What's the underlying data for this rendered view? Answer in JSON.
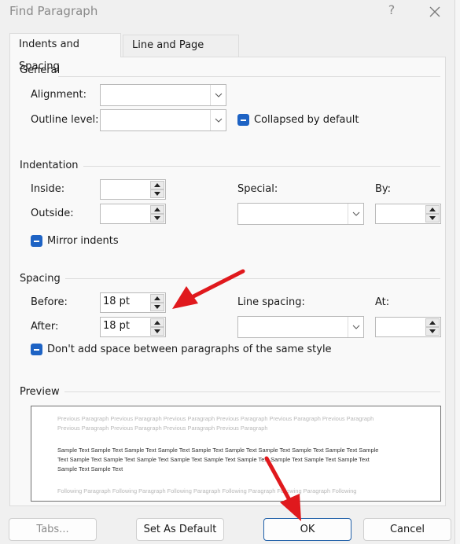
{
  "window": {
    "title": "Find Paragraph",
    "help_label": "?",
    "close_icon": "close-icon"
  },
  "tabs": [
    {
      "label": "Indents and Spacing",
      "mnemonic": "I",
      "active": true
    },
    {
      "label": "Line and Page Breaks",
      "mnemonic": "P",
      "active": false
    }
  ],
  "general": {
    "title": "General",
    "alignment_label": "Alignment:",
    "alignment_value": "",
    "outline_label": "Outline level:",
    "outline_value": "",
    "collapsed_label": "Collapsed by default",
    "collapsed_state": "indeterminate"
  },
  "indentation": {
    "title": "Indentation",
    "inside_label": "Inside:",
    "inside_value": "",
    "outside_label": "Outside:",
    "outside_value": "",
    "special_label": "Special:",
    "special_value": "",
    "by_label": "By:",
    "by_value": "",
    "mirror_label": "Mirror indents",
    "mirror_state": "indeterminate"
  },
  "spacing": {
    "title": "Spacing",
    "before_label": "Before:",
    "before_value": "18 pt",
    "after_label": "After:",
    "after_value": "18 pt",
    "line_spacing_label": "Line spacing:",
    "line_spacing_value": "",
    "at_label": "At:",
    "at_value": "",
    "dont_add_label": "Don't add space between paragraphs of the same style",
    "dont_add_state": "indeterminate"
  },
  "preview": {
    "title": "Preview",
    "previous_line1": "Previous Paragraph Previous Paragraph Previous Paragraph Previous Paragraph Previous Paragraph Previous Paragraph",
    "previous_line2": "Previous Paragraph Previous Paragraph Previous Paragraph Previous Paragraph",
    "sample_line1": "Sample Text Sample Text Sample Text Sample Text Sample Text Sample Text Sample Text Sample Text Sample Text Sample",
    "sample_line2": "Text Sample Text Sample Text Sample Text Sample Text Sample Text Sample Text Sample Text Sample Text Sample Text",
    "sample_line3": "Sample Text Sample Text",
    "following_line1": "Following Paragraph Following Paragraph Following Paragraph Following Paragraph Following Paragraph Following"
  },
  "buttons": {
    "tabs": "Tabs...",
    "set_default": "Set As Default",
    "ok": "OK",
    "cancel": "Cancel"
  },
  "annotations": {
    "arrow_color": "#e0191d",
    "arrows": [
      "arrow-to-spacing-before",
      "arrow-to-ok-button"
    ]
  },
  "colors": {
    "checkbox_accent": "#1e63c4",
    "default_button_border": "#1f5fa8"
  }
}
